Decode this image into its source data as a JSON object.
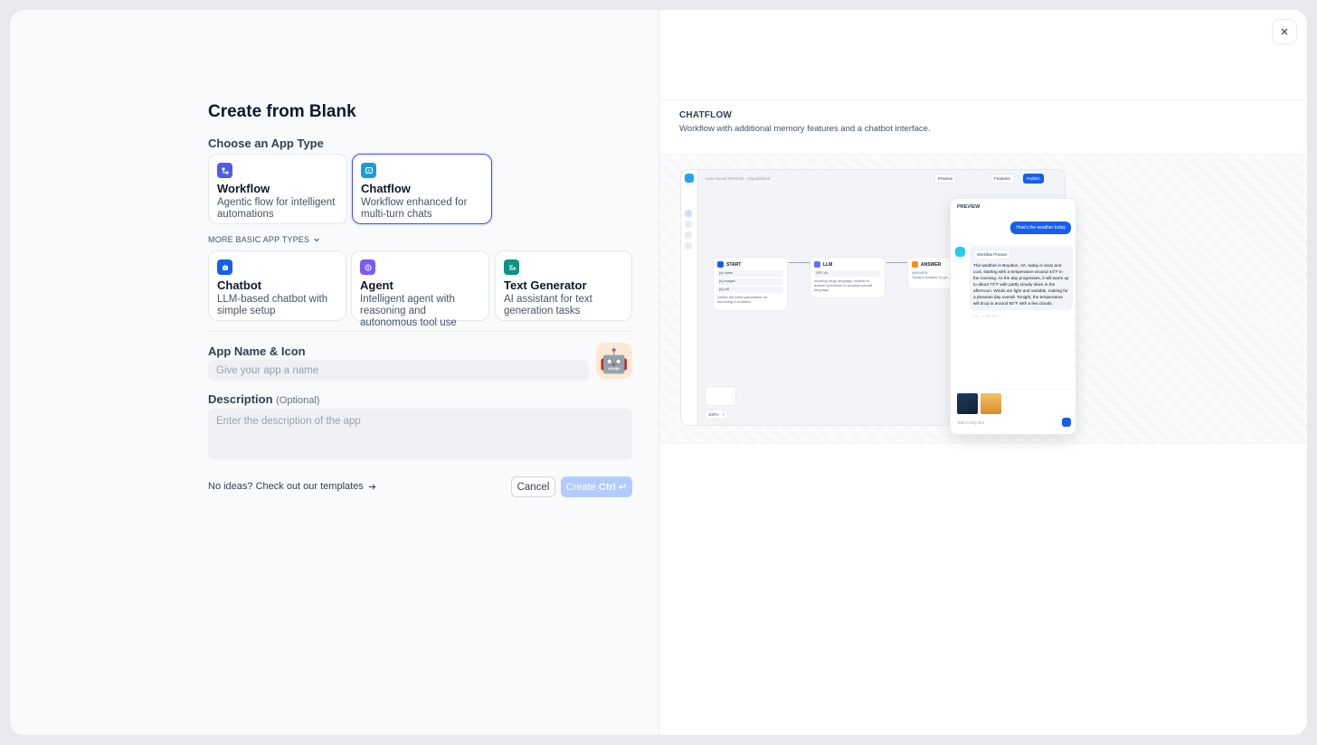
{
  "dialog": {
    "title": "Create from Blank",
    "choose_type_label": "Choose an App Type",
    "primary_types": [
      {
        "name": "Workflow",
        "desc": "Agentic flow for intelligent automations"
      },
      {
        "name": "Chatflow",
        "desc": "Workflow enhanced for multi-turn chats"
      }
    ],
    "more_types_label": "MORE BASIC APP TYPES",
    "basic_types": [
      {
        "name": "Chatbot",
        "desc": "LLM-based chatbot with simple setup"
      },
      {
        "name": "Agent",
        "desc": "Intelligent agent with reasoning and autonomous tool use"
      },
      {
        "name": "Text Generator",
        "desc": "AI assistant for text generation tasks"
      }
    ],
    "name_icon_label": "App Name & Icon",
    "name_placeholder": "Give your app a name",
    "avatar_emoji": "🤖",
    "description_label": "Description",
    "description_optional": "(Optional)",
    "description_placeholder": "Enter the description of the app",
    "templates_link": "No ideas? Check out our templates",
    "cancel_label": "Cancel",
    "create_label": "Create",
    "create_shortcut": "Ctrl ↵"
  },
  "preview": {
    "type": "CHATFLOW",
    "description": "Workflow with additional memory features and a chatbot interface.",
    "canvas_status": "Auto-Saved 09:02:06 · Unpublished",
    "toolbar": {
      "preview": "Preview",
      "features": "Features",
      "publish": "Publish"
    },
    "nodes": {
      "start": "START",
      "llm": "LLM",
      "answer": "ANSWER"
    },
    "start_rows": [
      "{x} name",
      "{x} images",
      "{x} pdf"
    ],
    "start_desc": "Define the initial parameters for launching a workflow",
    "llm_model": "GPT-4o",
    "llm_desc": "Invoking large language models to answer questions or process natural language",
    "answer_label": "ANSWER",
    "answer_text": "Today's weather in {{#...",
    "zoom": "100%",
    "chat_title": "PREVIEW",
    "chat_question": "How's the weather today",
    "workflow_process": "Workflow Process",
    "chat_answer": "The weather in Boydton, VA, today is clear and cool, starting with a temperature around 44°F in the morning. As the day progresses, it will warm up to about 73°F with partly cloudy skies in the afternoon. Winds are light and variable, making for a pleasant day overall. Tonight, the temperature will drop to around 50°F with a few clouds.",
    "chat_time": "6.0s · 1.58 PM",
    "chat_placeholder": "Talk to Dify Bot"
  },
  "colors": {
    "workflow_icon": "#4e5ee4",
    "chatflow_icon": "#1e9ad6",
    "chatbot_icon": "#155eef",
    "agent_icon": "#7a5af8",
    "textgen_icon": "#0e9384",
    "selected_border": "#444ce7",
    "create_disabled": "#b2ccff"
  }
}
